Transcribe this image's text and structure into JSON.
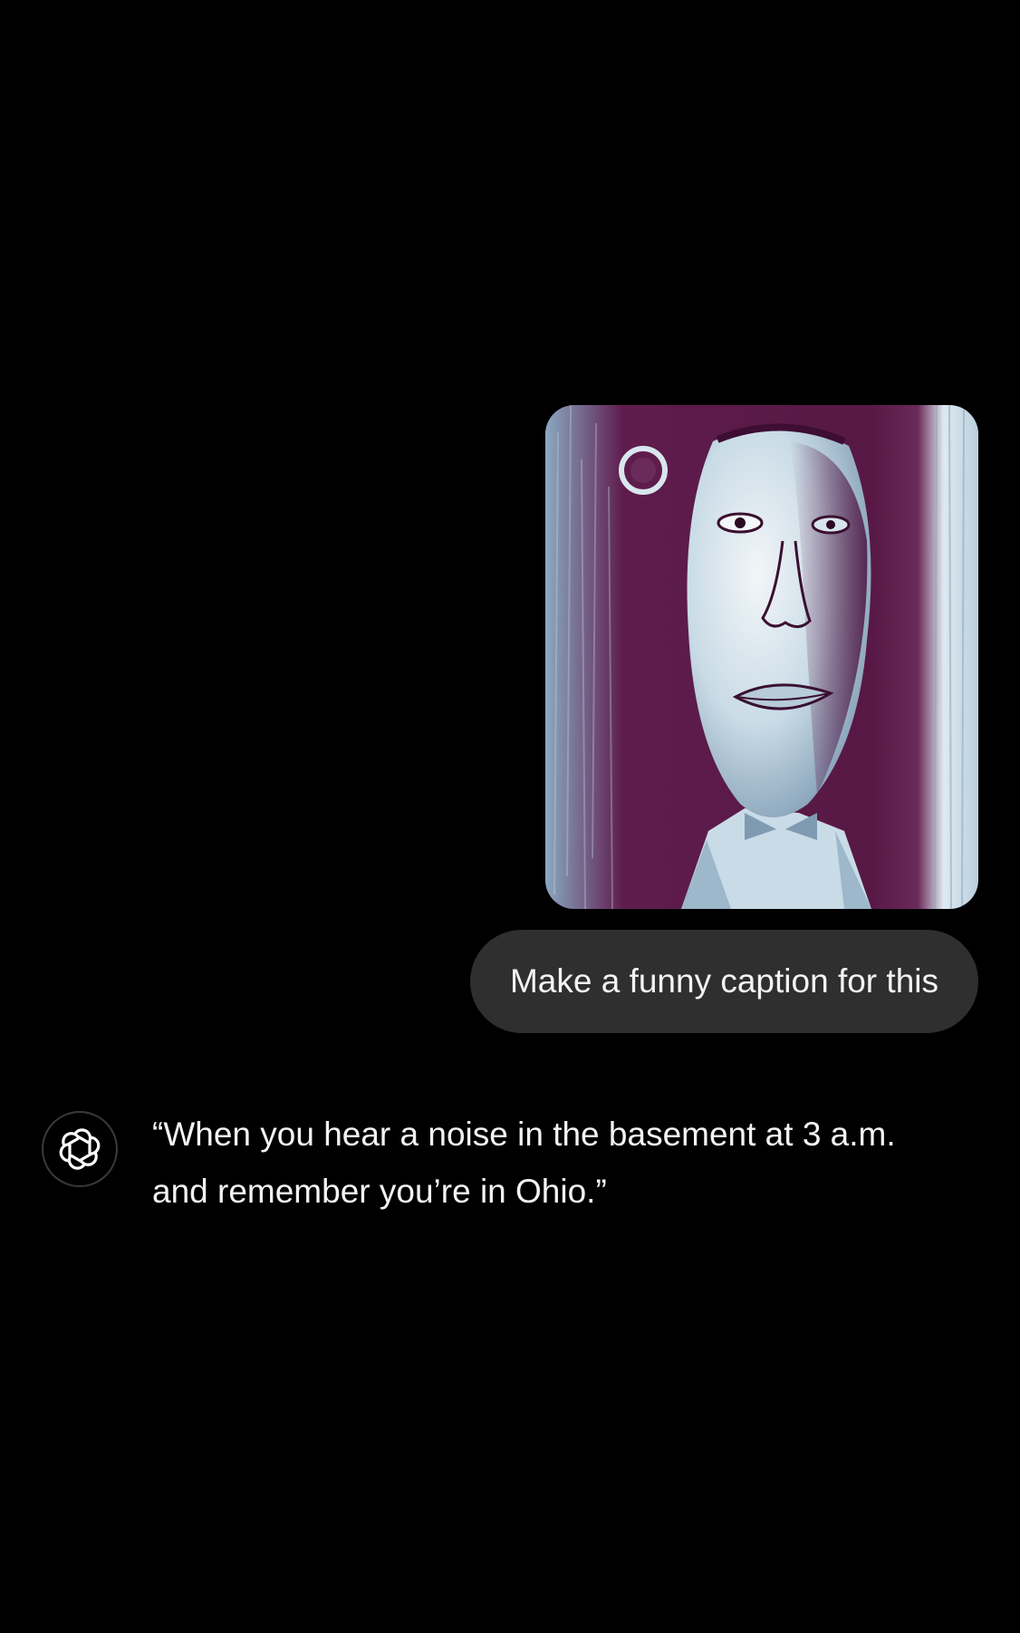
{
  "conversation": {
    "user_message": {
      "attachment_icon": "artwork-image",
      "text": "Make a funny caption for this"
    },
    "assistant_message": {
      "avatar_icon": "openai-logo-icon",
      "text": "“When you hear a noise in the basement at 3 a.m. and remember you’re in Ohio.”"
    }
  },
  "colors": {
    "background": "#000000",
    "user_bubble": "#2f2f2f",
    "text": "#f3f3f3",
    "artwork_dark": "#5a1a4a",
    "artwork_light": "#d7e6ef"
  }
}
